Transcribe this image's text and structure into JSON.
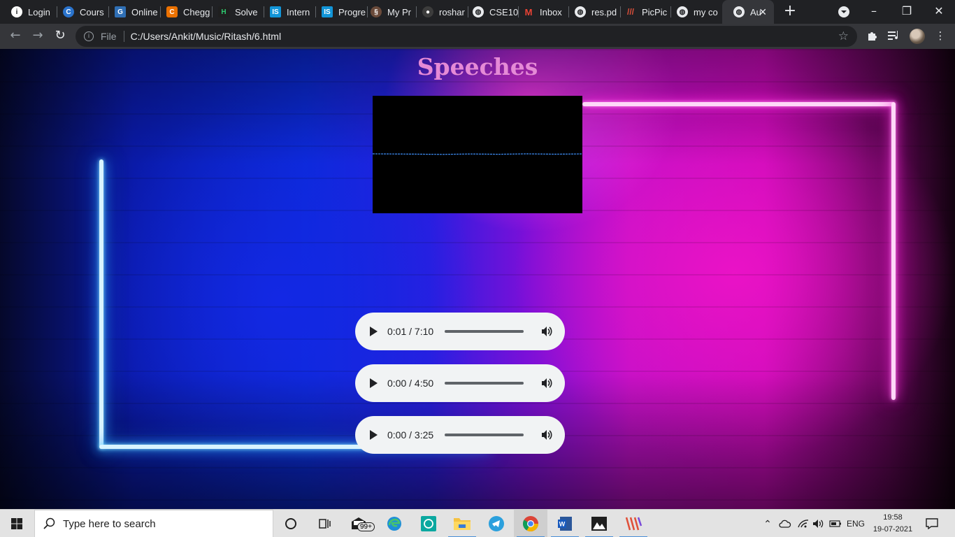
{
  "browser": {
    "tabs": [
      {
        "title": "Login",
        "icon": "info-circle-icon",
        "color": "#ffffff"
      },
      {
        "title": "Cours",
        "icon": "coursera-icon",
        "color": "#2a73cc"
      },
      {
        "title": "Online",
        "icon": "online-icon",
        "color": "#2f6fb5"
      },
      {
        "title": "Chegg",
        "icon": "chegg-icon",
        "color": "#eb7100"
      },
      {
        "title": "Solve",
        "icon": "solve-icon",
        "color": "#1f1f1f"
      },
      {
        "title": "Intern",
        "icon": "internshala-icon",
        "color": "#1295d8"
      },
      {
        "title": "Progre",
        "icon": "internshala-icon",
        "color": "#1295d8"
      },
      {
        "title": "My Pr",
        "icon": "profile-swirl-icon",
        "color": "#6a4a3a"
      },
      {
        "title": "roshar",
        "icon": "github-icon",
        "color": "#3c3c3c"
      },
      {
        "title": "CSE10",
        "icon": "globe-icon",
        "color": "#e8eaed"
      },
      {
        "title": "Inbox",
        "icon": "gmail-icon",
        "color": "#ea4335"
      },
      {
        "title": "res.pd",
        "icon": "globe-icon",
        "color": "#e8eaed"
      },
      {
        "title": "PicPic",
        "icon": "picpick-icon",
        "color": "#e0503a"
      },
      {
        "title": "my co",
        "icon": "globe-icon",
        "color": "#e8eaed"
      },
      {
        "title": "Au",
        "icon": "globe-icon",
        "color": "#e8eaed",
        "active": true
      }
    ],
    "new_tab_label": "+",
    "address": {
      "scheme_label": "File",
      "url": "C:/Users/Ankit/Music/Ritash/6.html"
    }
  },
  "page": {
    "title": "Speeches",
    "players": [
      {
        "time": "0:01 / 7:10",
        "progress": 0.0023
      },
      {
        "time": "0:00 / 4:50",
        "progress": 0
      },
      {
        "time": "0:00 / 3:25",
        "progress": 0
      }
    ]
  },
  "taskbar": {
    "search_placeholder": "Type here to search",
    "mail_badge": "99+",
    "language": "ENG",
    "time": "19:58",
    "date": "19-07-2021"
  }
}
